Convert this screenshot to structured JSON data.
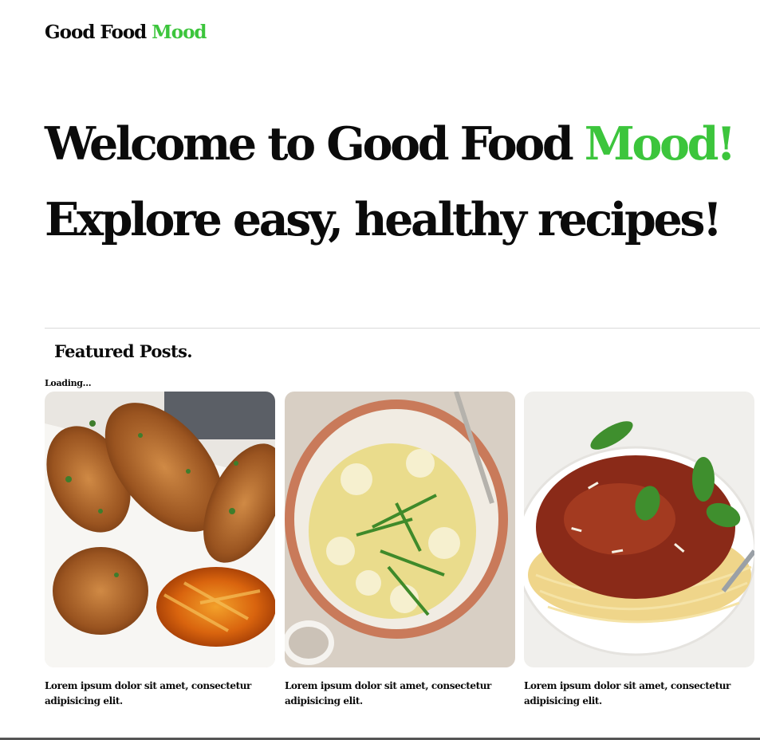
{
  "brand": {
    "part1": "Good Food ",
    "part2": "Mood"
  },
  "hero": {
    "line1_part1": "Welcome to Good Food ",
    "line1_part2": "Mood",
    "line1_part3": "!",
    "line2": "Explore easy, healthy recipes!"
  },
  "featured": {
    "title": "Featured Posts.",
    "loading": "Loading...",
    "cards": [
      {
        "image": "crispy-chicken-tenders-photo",
        "text": "Lorem ipsum dolor sit amet, consectetur adipisicing elit."
      },
      {
        "image": "orzo-cauliflower-salad-photo",
        "text": "Lorem ipsum dolor sit amet, consectetur adipisicing elit."
      },
      {
        "image": "spaghetti-bolognese-photo",
        "text": "Lorem ipsum dolor sit amet, consectetur adipisicing elit."
      }
    ]
  },
  "colors": {
    "accent": "#3cc53c",
    "text": "#0b0b0b",
    "divider": "#d9d9d9"
  }
}
